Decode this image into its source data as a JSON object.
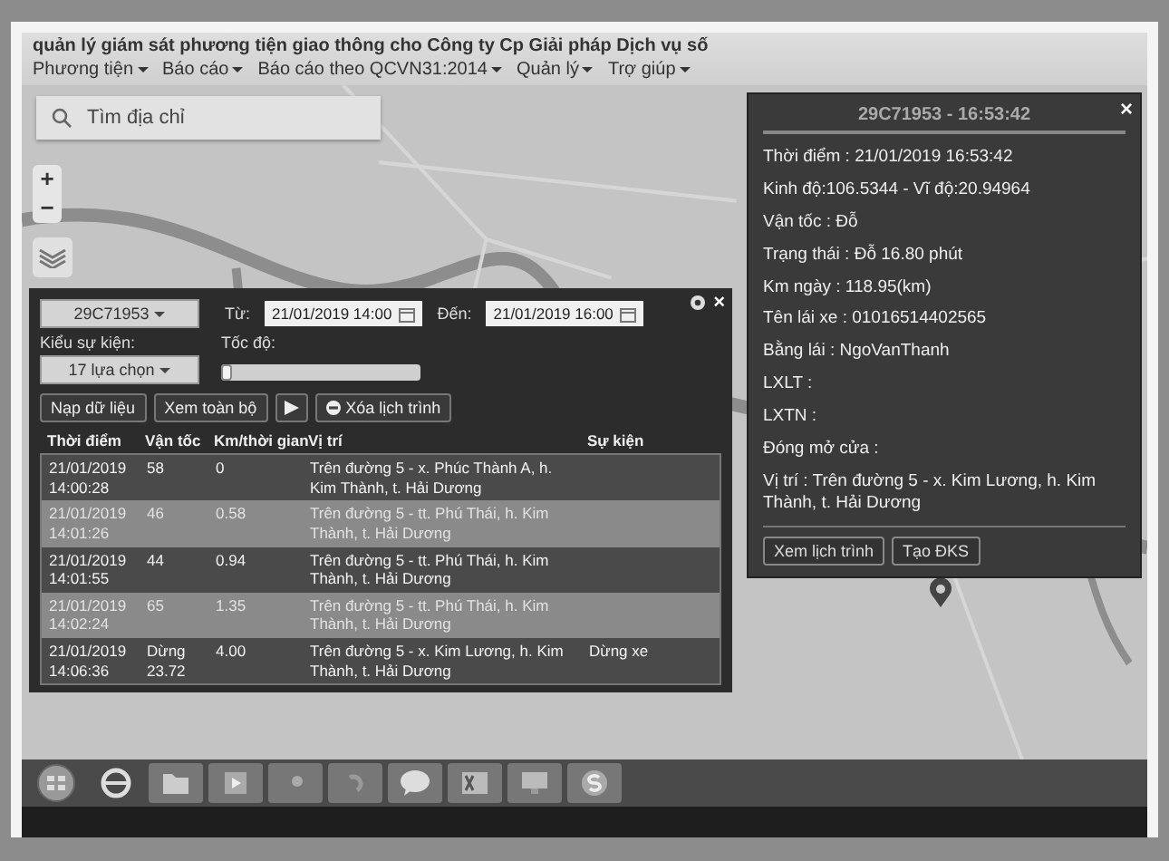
{
  "header": {
    "title": "quản lý giám sát phương tiện giao thông cho Công ty Cp Giải pháp Dịch vụ số",
    "menu": [
      {
        "label": "Phương tiện"
      },
      {
        "label": "Báo cáo"
      },
      {
        "label": "Báo cáo theo QCVN31:2014"
      },
      {
        "label": "Quản lý"
      },
      {
        "label": "Trợ giúp"
      }
    ]
  },
  "map": {
    "search": {
      "placeholder": "Tìm địa chỉ"
    },
    "zoom_in": "+",
    "zoom_out": "−"
  },
  "popup": {
    "title": "29C71953 - 16:53:42",
    "close": "×",
    "fields": [
      "Thời điểm : 21/01/2019 16:53:42",
      "Kinh độ:106.5344 - Vĩ độ:20.94964",
      "Vận tốc : Đỗ",
      "Trạng thái : Đỗ 16.80 phút",
      "Km ngày : 118.95(km)",
      "Tên lái xe : 01016514402565",
      "Bằng lái : NgoVanThanh",
      "LXLT :",
      "LXTN :",
      "Đóng mở cửa :",
      "Vị trí : Trên đường 5 - x. Kim Lương, h. Kim Thành, t. Hải Dương"
    ],
    "buttons": [
      "Xem lịch trình",
      "Tạo ĐKS"
    ]
  },
  "history": {
    "vehicle": "29C71953",
    "from_label": "Từ:",
    "from": "21/01/2019 14:00",
    "to_label": "Đến:",
    "to": "21/01/2019 16:00",
    "event_label": "Kiểu sự kiện:",
    "event_value": "17 lựa chọn",
    "speed_label": "Tốc độ:",
    "speed": {
      "level": 0.05
    },
    "load": "Nạp dữ liệu",
    "view_all": "Xem toàn bộ",
    "clear": "Xóa lịch trình",
    "close": "×",
    "columns": [
      "Thời điểm",
      "Vận tốc",
      "Km/thời gian",
      "Vị trí",
      "Sự kiện"
    ],
    "rows": [
      {
        "time": "21/01/2019 14:00:28",
        "speed": "58",
        "km": "0",
        "place": "Trên đường 5 - x. Phúc Thành A, h. Kim Thành, t. Hải Dương"
      },
      {
        "time": "21/01/2019 14:01:26",
        "speed": "46",
        "km": "0.58",
        "place": "Trên đường 5 - tt. Phú Thái, h. Kim Thành, t. Hải Dương"
      },
      {
        "time": "21/01/2019 14:01:55",
        "speed": "44",
        "km": "0.94",
        "place": "Trên đường 5 - tt. Phú Thái, h. Kim Thành, t. Hải Dương"
      },
      {
        "time": "21/01/2019 14:02:24",
        "speed": "65",
        "km": "1.35",
        "place": "Trên đường 5 - tt. Phú Thái, h. Kim Thành, t. Hải Dương"
      },
      {
        "time": "21/01/2019 14:06:36",
        "speed": "Dừng 23.72",
        "km": "4.00",
        "place": "Trên đường 5 - x. Kim Lương, h. Kim Thành, t. Hải Dương",
        "event": "Dừng xe"
      }
    ]
  }
}
